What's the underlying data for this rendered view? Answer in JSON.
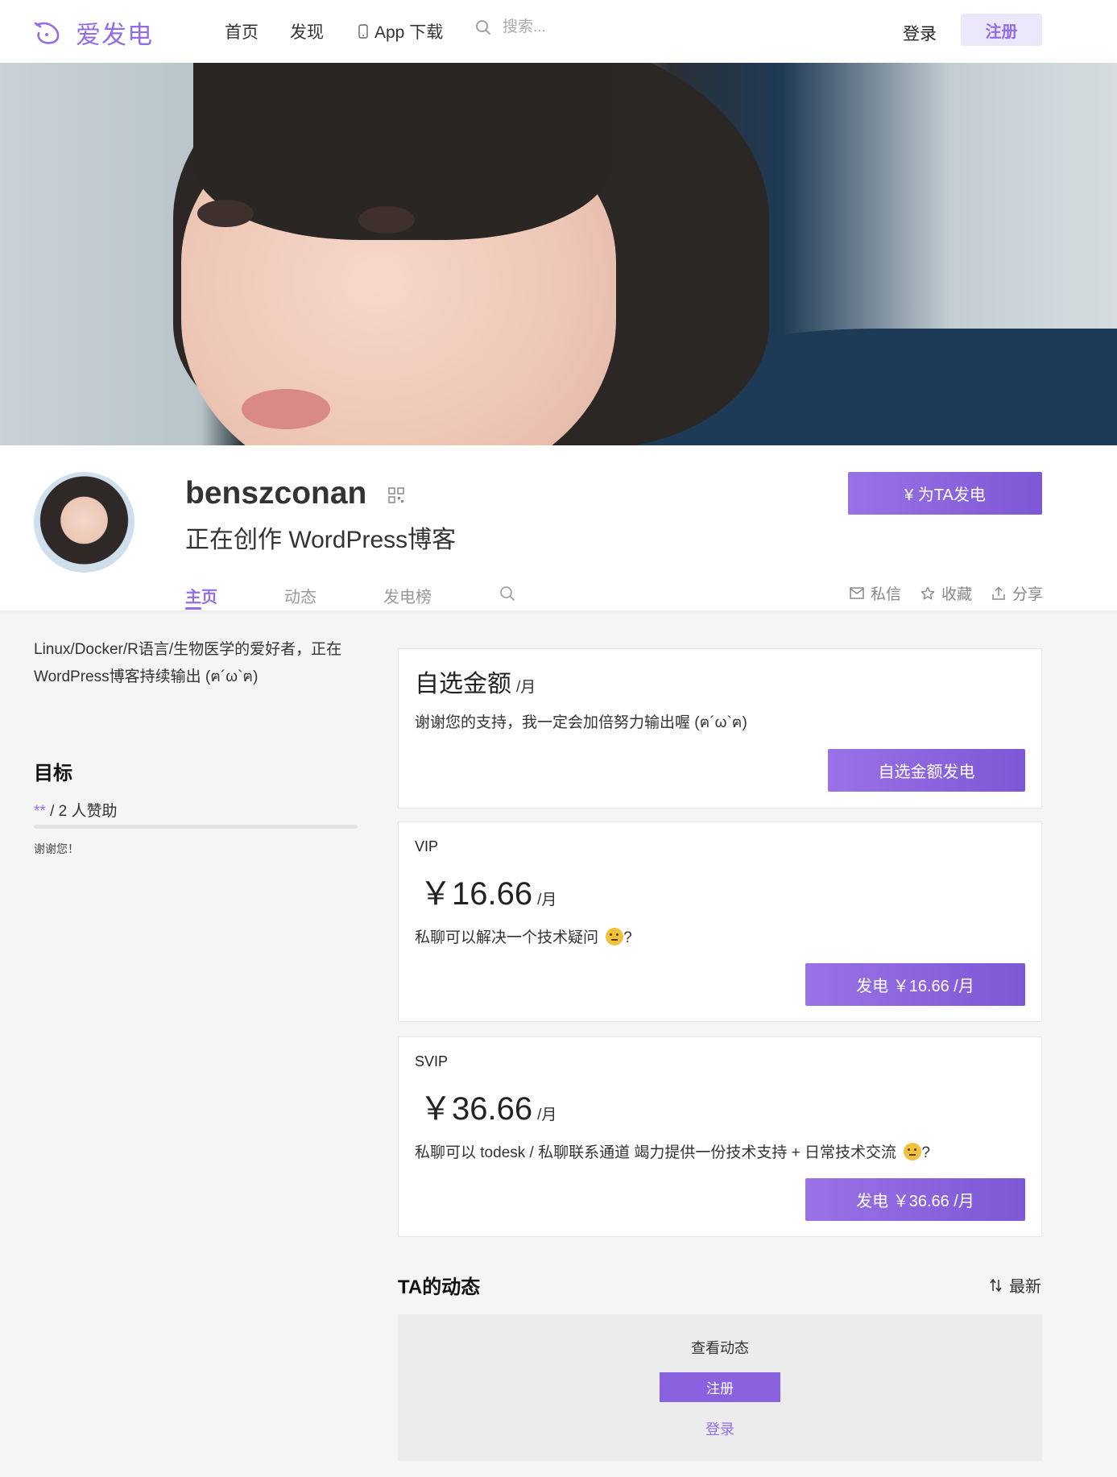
{
  "header": {
    "brand": "爱发电",
    "nav": [
      "首页",
      "发现",
      "App 下载"
    ],
    "search_placeholder": "搜索...",
    "login": "登录",
    "register": "注册"
  },
  "profile": {
    "username": "benszconan",
    "subtitle": "正在创作 WordPress博客",
    "tip_button": "¥  为TA发电",
    "tabs": [
      "主页",
      "动态",
      "发电榜"
    ],
    "actions": [
      "私信",
      "收藏",
      "分享"
    ]
  },
  "left": {
    "bio": "Linux/Docker/R语言/生物医学的爱好者，正在WordPress博客持续输出 (ฅ´ω`ฅ)",
    "goal_title": "目标",
    "goal_stars": "**",
    "goal_text": " / 2 人赞助",
    "goal_progress": 0,
    "goal_note": "谢谢您！"
  },
  "custom_card": {
    "title": "自选金额",
    "unit": "/月",
    "desc": "谢谢您的支持，我一定会加倍努力输出喔 (ฅ´ω`ฅ)",
    "button": "自选金额发电"
  },
  "plans": [
    {
      "name": "VIP",
      "price": "￥16.66",
      "unit": "/月",
      "desc": "私聊可以解决一个技术疑问",
      "desc_tail": "?",
      "button": "发电 ￥16.66 /月"
    },
    {
      "name": "SVIP",
      "price": "￥36.66",
      "unit": "/月",
      "desc": "私聊可以 todesk / 私聊联系通道 竭力提供一份技术支持 + 日常技术交流",
      "desc_tail": "?",
      "button": "发电 ￥36.66 /月"
    }
  ],
  "feed": {
    "title": "TA的动态",
    "sort": "最新",
    "view": "查看动态",
    "register": "注册",
    "login": "登录"
  },
  "colors": {
    "accent": "#946ce6",
    "accent_light": "#ece7fa"
  }
}
